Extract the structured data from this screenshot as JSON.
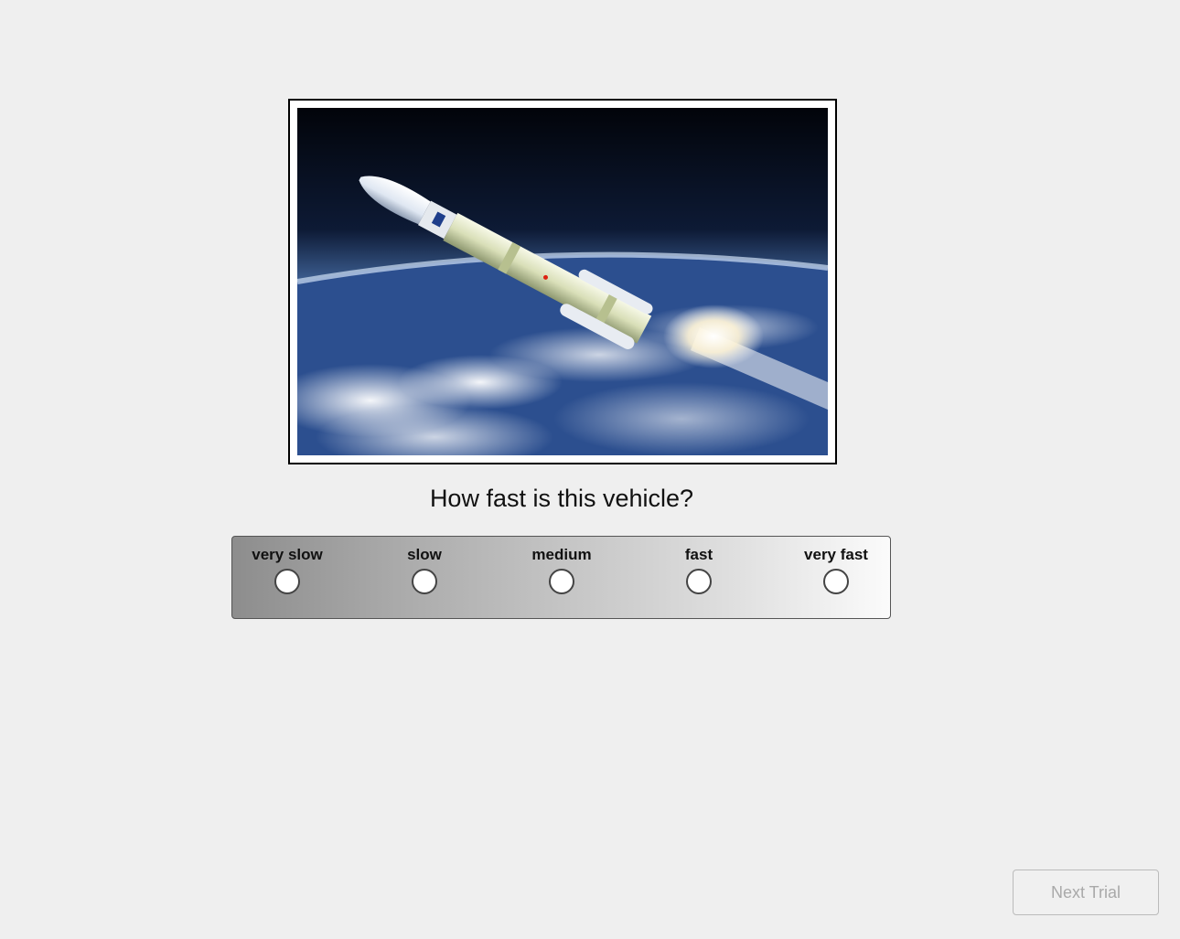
{
  "question": "How fast is this vehicle?",
  "image": {
    "subject": "rocket-launch-over-earth"
  },
  "scale": {
    "options": [
      {
        "label": "very slow"
      },
      {
        "label": "slow"
      },
      {
        "label": "medium"
      },
      {
        "label": "fast"
      },
      {
        "label": "very fast"
      }
    ],
    "selected": null,
    "gradient_start": "#8d8d8d",
    "gradient_end": "#fbfbfb"
  },
  "next_button": {
    "label": "Next Trial",
    "enabled": false
  }
}
